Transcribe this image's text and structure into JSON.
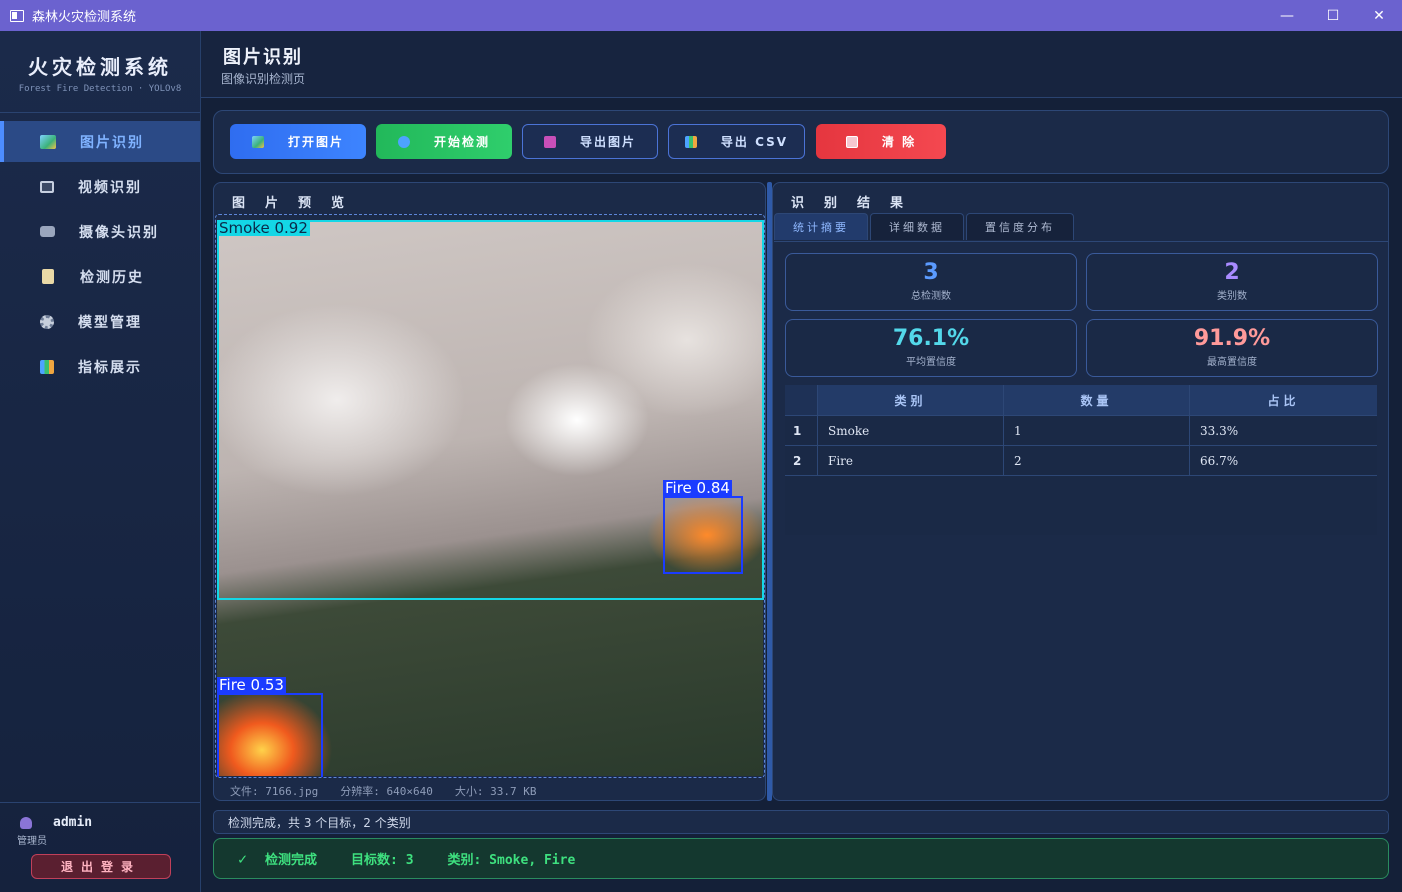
{
  "window": {
    "title": "森林火灾检测系统",
    "minimize": "—",
    "maximize": "☐",
    "close": "✕"
  },
  "sidebar": {
    "brand_title": "火灾检测系统",
    "brand_sub": "Forest Fire Detection · YOLOv8",
    "items": [
      {
        "label": "图片识别",
        "icon": "image-icon",
        "active": true
      },
      {
        "label": "视频识别",
        "icon": "video-icon",
        "active": false
      },
      {
        "label": "摄像头识别",
        "icon": "camera-icon",
        "active": false
      },
      {
        "label": "检测历史",
        "icon": "history-icon",
        "active": false
      },
      {
        "label": "模型管理",
        "icon": "gear-icon",
        "active": false
      },
      {
        "label": "指标展示",
        "icon": "chart-icon",
        "active": false
      }
    ],
    "user_name": "admin",
    "user_role": "管理员",
    "logout_label": "退出登录"
  },
  "header": {
    "title": "图片识别",
    "subtitle": "图像识别检测页"
  },
  "toolbar": {
    "open_label": "打开图片",
    "detect_label": "开始检测",
    "export_label": "导出图片",
    "csv_label": "导出 CSV",
    "clear_label": "清 除"
  },
  "preview": {
    "title": "图片预览",
    "detections": [
      {
        "label": "Smoke 0.92"
      },
      {
        "label": "Fire 0.84"
      },
      {
        "label": "Fire 0.53"
      }
    ],
    "file_name": "文件: 7166.jpg",
    "resolution": "分辨率: 640×640",
    "size": "大小: 33.7 KB"
  },
  "results": {
    "title": "识别结果",
    "tabs": [
      "统计摘要",
      "详细数据",
      "置信度分布"
    ],
    "stats": [
      {
        "value": "3",
        "label": "总检测数"
      },
      {
        "value": "2",
        "label": "类别数"
      },
      {
        "value": "76.1%",
        "label": "平均置信度"
      },
      {
        "value": "91.9%",
        "label": "最高置信度"
      }
    ],
    "table_headers": [
      "类别",
      "数量",
      "占比"
    ],
    "rows": [
      {
        "idx": "1",
        "cls": "Smoke",
        "count": "1",
        "pct": "33.3%"
      },
      {
        "idx": "2",
        "cls": "Fire",
        "count": "2",
        "pct": "66.7%"
      }
    ]
  },
  "status": {
    "line": "检测完成，共 3 个目标，2 个类别",
    "result_check": "✓",
    "result_done": "检测完成",
    "result_count": "目标数: 3",
    "result_classes": "类别: Smoke, Fire"
  },
  "colors": {
    "accent": "#4d8dff",
    "title_bar": "#6b62cf",
    "success": "#3ee07f",
    "danger": "#e5363f"
  }
}
